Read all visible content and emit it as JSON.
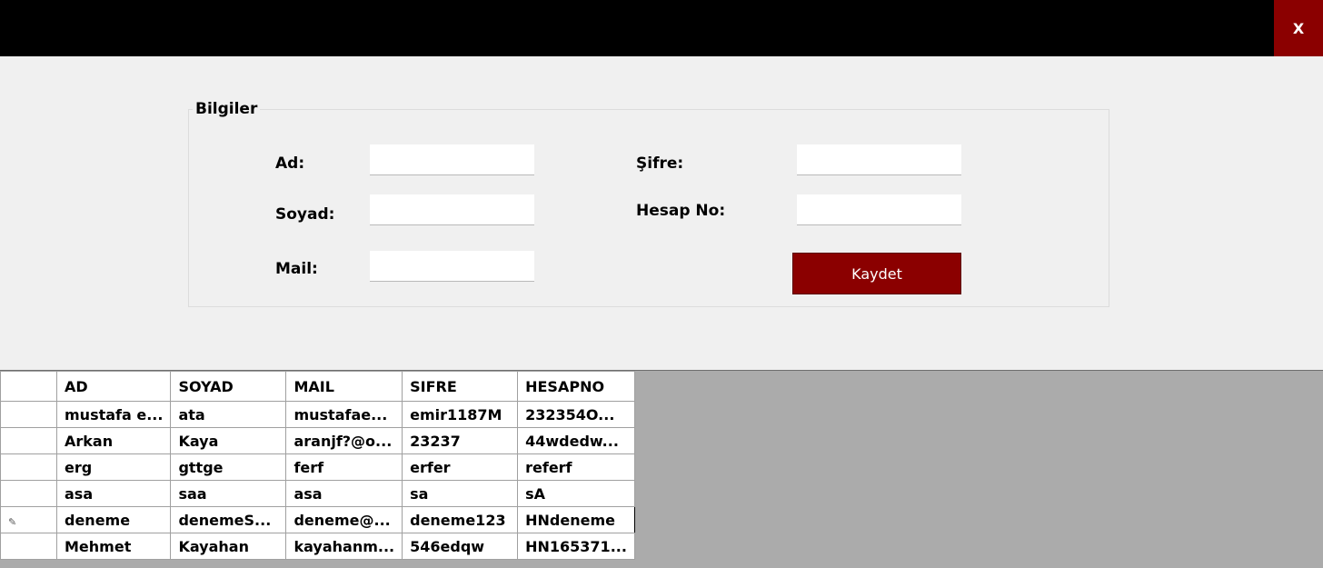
{
  "window": {
    "close_label": "X"
  },
  "form": {
    "group_title": "Bilgiler",
    "labels": {
      "ad": "Ad:",
      "soyad": "Soyad:",
      "mail": "Mail:",
      "sifre": "Şifre:",
      "hesapno": "Hesap No:"
    },
    "values": {
      "ad": "",
      "soyad": "",
      "mail": "",
      "sifre": "",
      "hesapno": ""
    },
    "save_label": "Kaydet"
  },
  "grid": {
    "columns": [
      "AD",
      "SOYAD",
      "MAIL",
      "SIFRE",
      "HESAPNO"
    ],
    "rows": [
      [
        "mustafa e...",
        "ata",
        "mustafae...",
        "emir1187M",
        "232354O..."
      ],
      [
        "Arkan",
        "Kaya",
        "aranjf?@o...",
        "23237",
        "44wdedw..."
      ],
      [
        "erg",
        "gttge",
        "ferf",
        "erfer",
        "referf"
      ],
      [
        "asa",
        "saa",
        "asa",
        "sa",
        "sA"
      ],
      [
        "deneme",
        "denemeS...",
        "deneme@...",
        "deneme123",
        "HNdeneme"
      ],
      [
        "Mehmet",
        "Kayahan",
        "kayahanm...",
        "546edqw",
        "HN165371..."
      ]
    ],
    "editing_row_indicator": "✎"
  },
  "colors": {
    "titlebar": "#000000",
    "accent": "#8b0000",
    "grid_background": "#ababab"
  }
}
